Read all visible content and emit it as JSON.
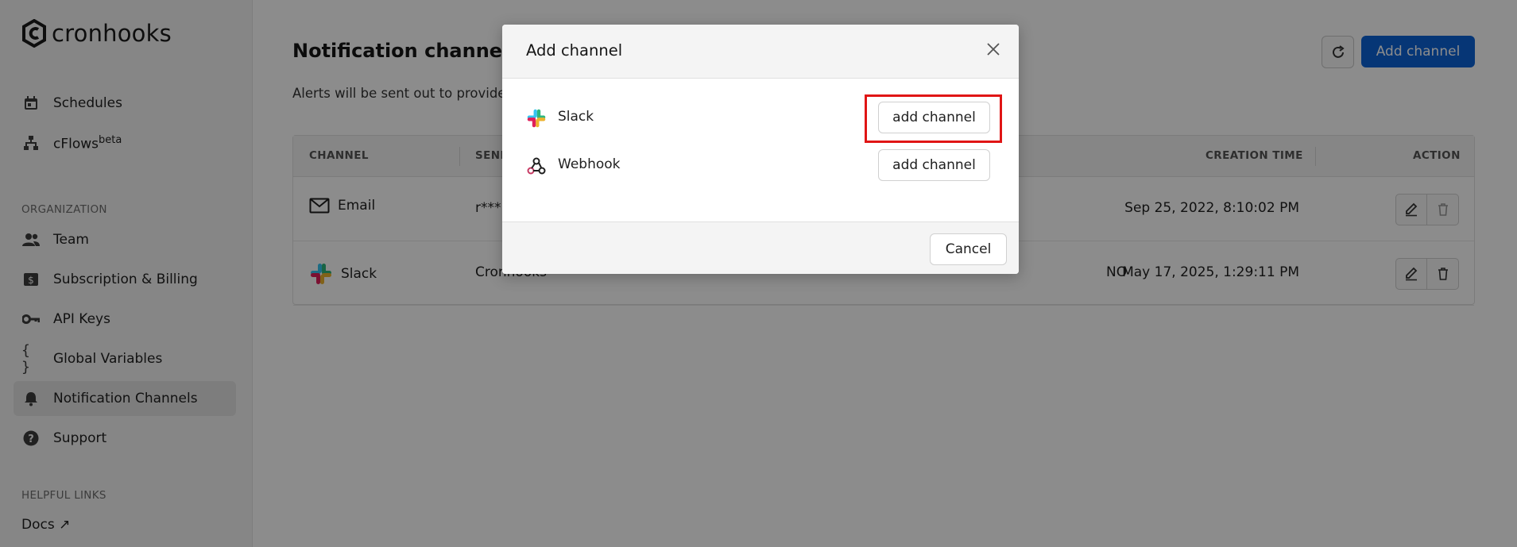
{
  "app": {
    "name": "cronhooks"
  },
  "sidebar": {
    "items": [
      {
        "label": "Schedules",
        "icon": "calendar-icon"
      },
      {
        "label": "cFlows",
        "sup": "beta",
        "icon": "flow-icon"
      }
    ],
    "org_label": "ORGANIZATION",
    "org_items": [
      {
        "label": "Team",
        "icon": "team-icon"
      },
      {
        "label": "Subscription & Billing",
        "icon": "billing-icon"
      },
      {
        "label": "API Keys",
        "icon": "key-icon"
      },
      {
        "label": "Global Variables",
        "icon": "braces-icon"
      },
      {
        "label": "Notification Channels",
        "icon": "bell-icon",
        "active": true
      },
      {
        "label": "Support",
        "icon": "help-icon"
      }
    ],
    "links_label": "HELPFUL LINKS",
    "docs_label": "Docs ↗"
  },
  "main": {
    "title": "Notification channels",
    "subtitle": "Alerts will be sent out to provide",
    "add_button": "Add channel",
    "table": {
      "headers": [
        "CHANNEL",
        "SENI",
        "CREATION TIME",
        "ACTION"
      ],
      "rows": [
        {
          "channel": "Email",
          "sender": "r***",
          "flag": "",
          "created": "Sep 25, 2022, 8:10:02 PM"
        },
        {
          "channel": "Slack",
          "sender": "Cronhooks",
          "flag": "NO",
          "created": "May 17, 2025, 1:29:11 PM"
        }
      ]
    }
  },
  "modal": {
    "title": "Add channel",
    "options": [
      {
        "label": "Slack",
        "button": "add channel"
      },
      {
        "label": "Webhook",
        "button": "add channel"
      }
    ],
    "cancel": "Cancel"
  },
  "colors": {
    "accent": "#0b63d8",
    "highlight": "#e01515"
  }
}
